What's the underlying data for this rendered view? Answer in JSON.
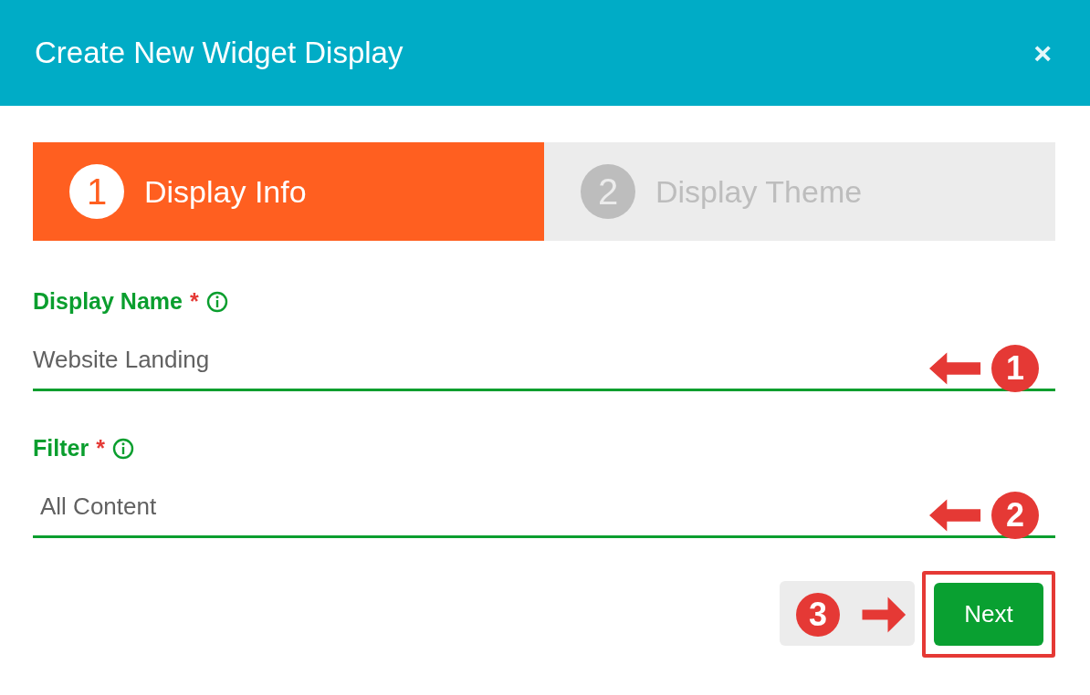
{
  "dialog": {
    "title": "Create New Widget Display",
    "close": "×"
  },
  "steps": [
    {
      "number": "1",
      "label": "Display Info",
      "selected": true
    },
    {
      "number": "2",
      "label": "Display Theme",
      "selected": false
    }
  ],
  "fields": [
    {
      "label": "Display Name",
      "required": "*",
      "value": "Website Landing",
      "kind": "input",
      "annotation": "1"
    },
    {
      "label": "Filter",
      "required": "*",
      "value": "All Content",
      "kind": "select",
      "annotation": "2"
    }
  ],
  "buttons": {
    "next": "Next",
    "next_annotation": "3"
  }
}
